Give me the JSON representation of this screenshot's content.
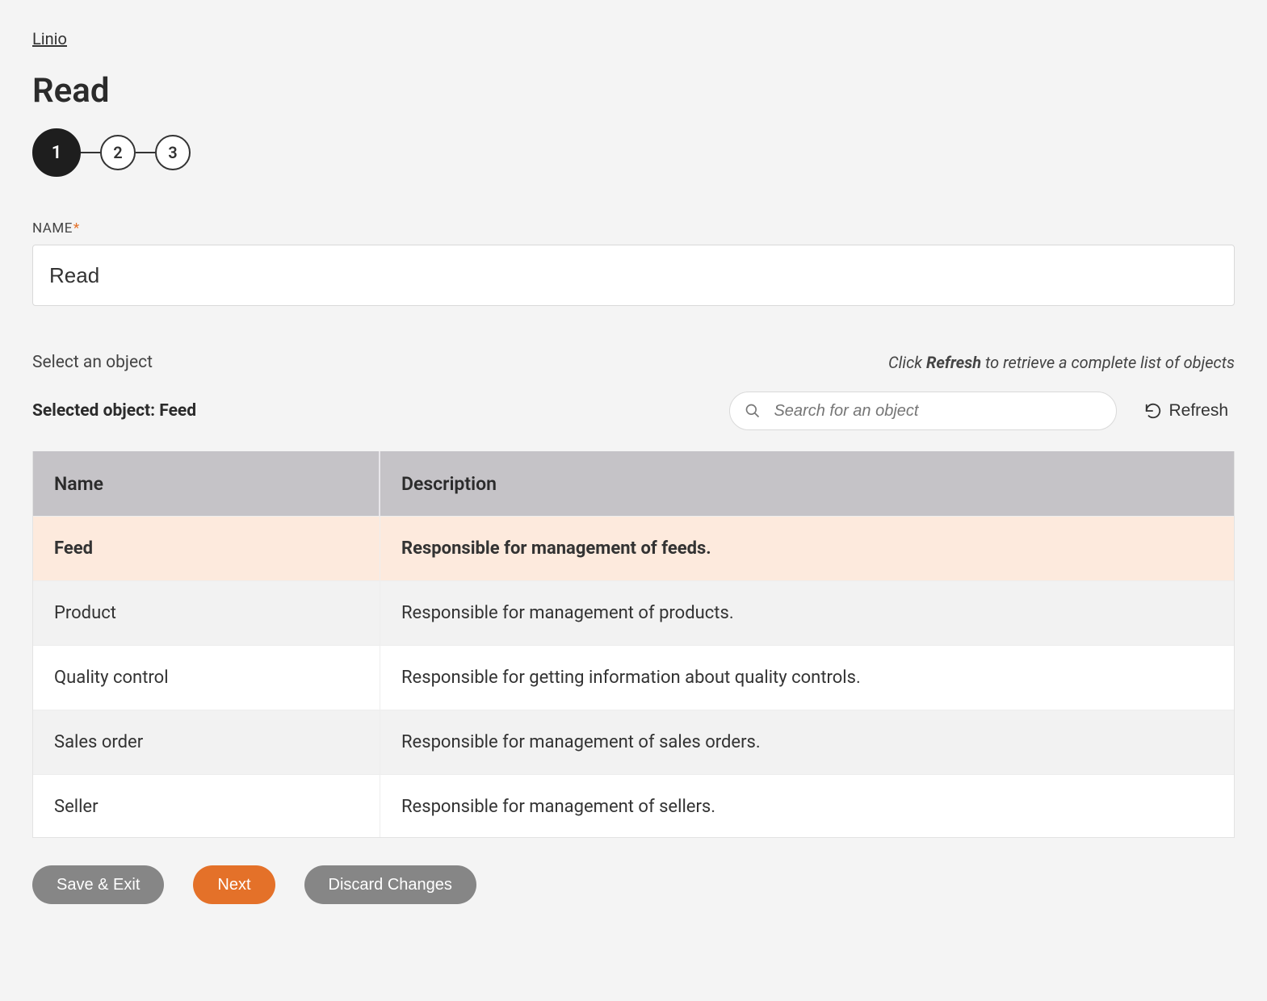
{
  "breadcrumb": {
    "label": "Linio"
  },
  "page_title": "Read",
  "stepper": {
    "steps": [
      "1",
      "2",
      "3"
    ],
    "active_index": 0
  },
  "form": {
    "name_label": "NAME",
    "name_required_mark": "*",
    "name_value": "Read"
  },
  "object_picker": {
    "select_label": "Select an object",
    "hint_prefix": "Click ",
    "hint_bold": "Refresh",
    "hint_suffix": " to retrieve a complete list of objects",
    "selected_prefix": "Selected object: ",
    "selected_value": "Feed",
    "search_placeholder": "Search for an object",
    "refresh_label": "Refresh"
  },
  "table": {
    "columns": {
      "name": "Name",
      "description": "Description"
    },
    "selected_index": 0,
    "rows": [
      {
        "name": "Feed",
        "description": "Responsible for management of feeds."
      },
      {
        "name": "Product",
        "description": "Responsible for management of products."
      },
      {
        "name": "Quality control",
        "description": "Responsible for getting information about quality controls."
      },
      {
        "name": "Sales order",
        "description": "Responsible for management of sales orders."
      },
      {
        "name": "Seller",
        "description": "Responsible for management of sellers."
      }
    ]
  },
  "footer": {
    "save_exit": "Save & Exit",
    "next": "Next",
    "discard": "Discard Changes"
  }
}
